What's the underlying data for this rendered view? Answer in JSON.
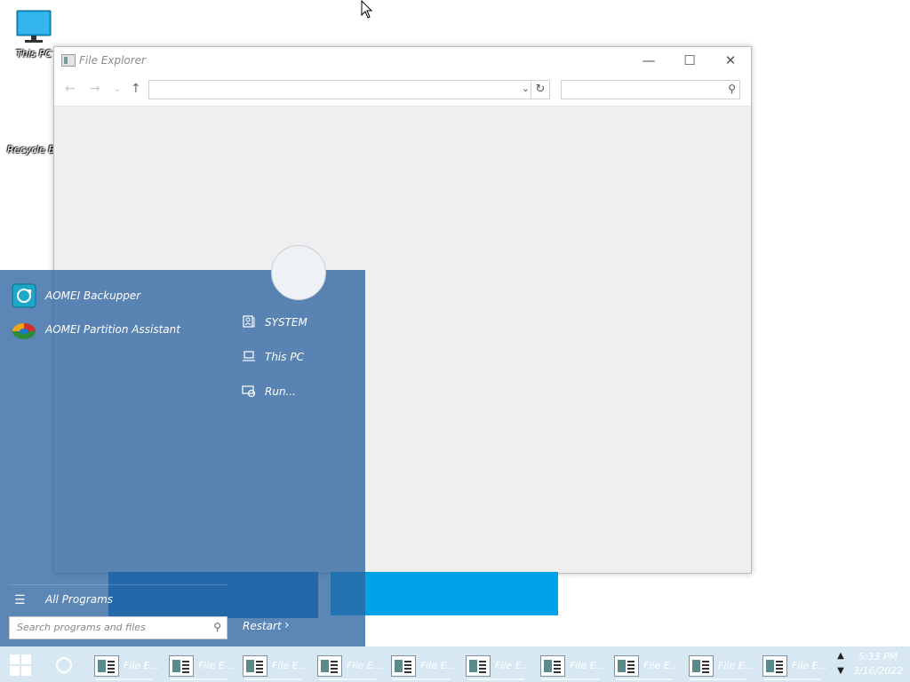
{
  "desktop": {
    "icons": [
      {
        "label": "This PC",
        "icon": "monitor-icon"
      },
      {
        "label": "Recycle Bi",
        "icon": "recycle-bin-icon"
      }
    ]
  },
  "explorer": {
    "title": "File Explorer",
    "address_value": "",
    "search_placeholder": "",
    "caption_buttons": {
      "minimize": "—",
      "maximize": "☐",
      "close": "✕"
    },
    "nav_icons": {
      "back": "←",
      "forward": "→",
      "recent": "⌄",
      "up": "↑",
      "refresh": "↻",
      "dropdown": "⌄",
      "search": "⚲"
    }
  },
  "start_menu": {
    "apps": [
      {
        "label": "AOMEI Backupper",
        "icon": "aomei-backupper-icon"
      },
      {
        "label": "AOMEI Partition Assistant",
        "icon": "aomei-partition-assistant-icon"
      }
    ],
    "right_items": [
      {
        "label": "SYSTEM",
        "icon": "user-icon"
      },
      {
        "label": "This PC",
        "icon": "laptop-icon"
      },
      {
        "label": "Run...",
        "icon": "run-icon"
      }
    ],
    "all_programs": "All Programs",
    "search_placeholder": "Search programs and files",
    "restart_label": "Restart",
    "restart_arrow": "›",
    "all_programs_icon": "☰"
  },
  "taskbar": {
    "buttons": [
      "File E...",
      "File E...",
      "File E...",
      "File E...",
      "File E...",
      "File E...",
      "File E...",
      "File E...",
      "File E...",
      "File E..."
    ],
    "scroll_up": "▲",
    "scroll_down": "▼",
    "time": "5:33 PM",
    "date": "3/16/2022"
  },
  "colors": {
    "start_menu_bg": "#2d64a0",
    "accent_blue": "#00a2e8",
    "taskbar_bg": "#d7e8f3"
  }
}
